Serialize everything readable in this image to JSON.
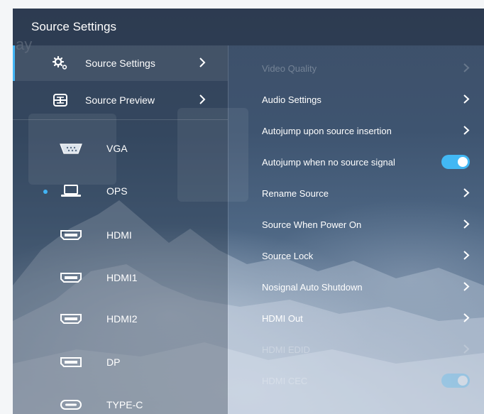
{
  "header": {
    "title": "Source Settings",
    "watermark": "ay"
  },
  "nav": {
    "items": [
      {
        "label": "Source Settings",
        "icon": "gear-icon",
        "active": true
      },
      {
        "label": "Source Preview",
        "icon": "preview-grid-icon",
        "active": false
      }
    ]
  },
  "sources": {
    "items": [
      {
        "label": "VGA",
        "icon": "vga-port-icon",
        "selected": false
      },
      {
        "label": "OPS",
        "icon": "laptop-icon",
        "selected": true
      },
      {
        "label": "HDMI",
        "icon": "hdmi-port-icon",
        "selected": false
      },
      {
        "label": "HDMI1",
        "icon": "hdmi-port-icon",
        "selected": false
      },
      {
        "label": "HDMI2",
        "icon": "hdmi-port-icon",
        "selected": false
      },
      {
        "label": "DP",
        "icon": "displayport-icon",
        "selected": false
      },
      {
        "label": "TYPE-C",
        "icon": "usb-c-port-icon",
        "selected": false
      }
    ]
  },
  "settings": {
    "items": [
      {
        "label": "Video Quality",
        "control": "chevron",
        "enabled": false
      },
      {
        "label": "Audio Settings",
        "control": "chevron",
        "enabled": true
      },
      {
        "label": "Autojump upon source insertion",
        "control": "chevron",
        "enabled": true
      },
      {
        "label": "Autojump when no source signal",
        "control": "toggle",
        "on": true,
        "enabled": true
      },
      {
        "label": "Rename Source",
        "control": "chevron",
        "enabled": true
      },
      {
        "label": "Source When Power On",
        "control": "chevron",
        "enabled": true
      },
      {
        "label": "Source Lock",
        "control": "chevron",
        "enabled": true
      },
      {
        "label": "Nosignal Auto Shutdown",
        "control": "chevron",
        "enabled": true
      },
      {
        "label": "HDMI Out",
        "control": "chevron",
        "enabled": true
      },
      {
        "label": "HDMI EDID",
        "control": "chevron",
        "enabled": false
      },
      {
        "label": "HDMI CEC",
        "control": "toggle",
        "on": true,
        "enabled": false
      }
    ]
  },
  "colors": {
    "accent": "#42b4f4",
    "panel_top": "#3d4f68",
    "panel_bottom": "#8296ad",
    "text": "#ffffff"
  }
}
